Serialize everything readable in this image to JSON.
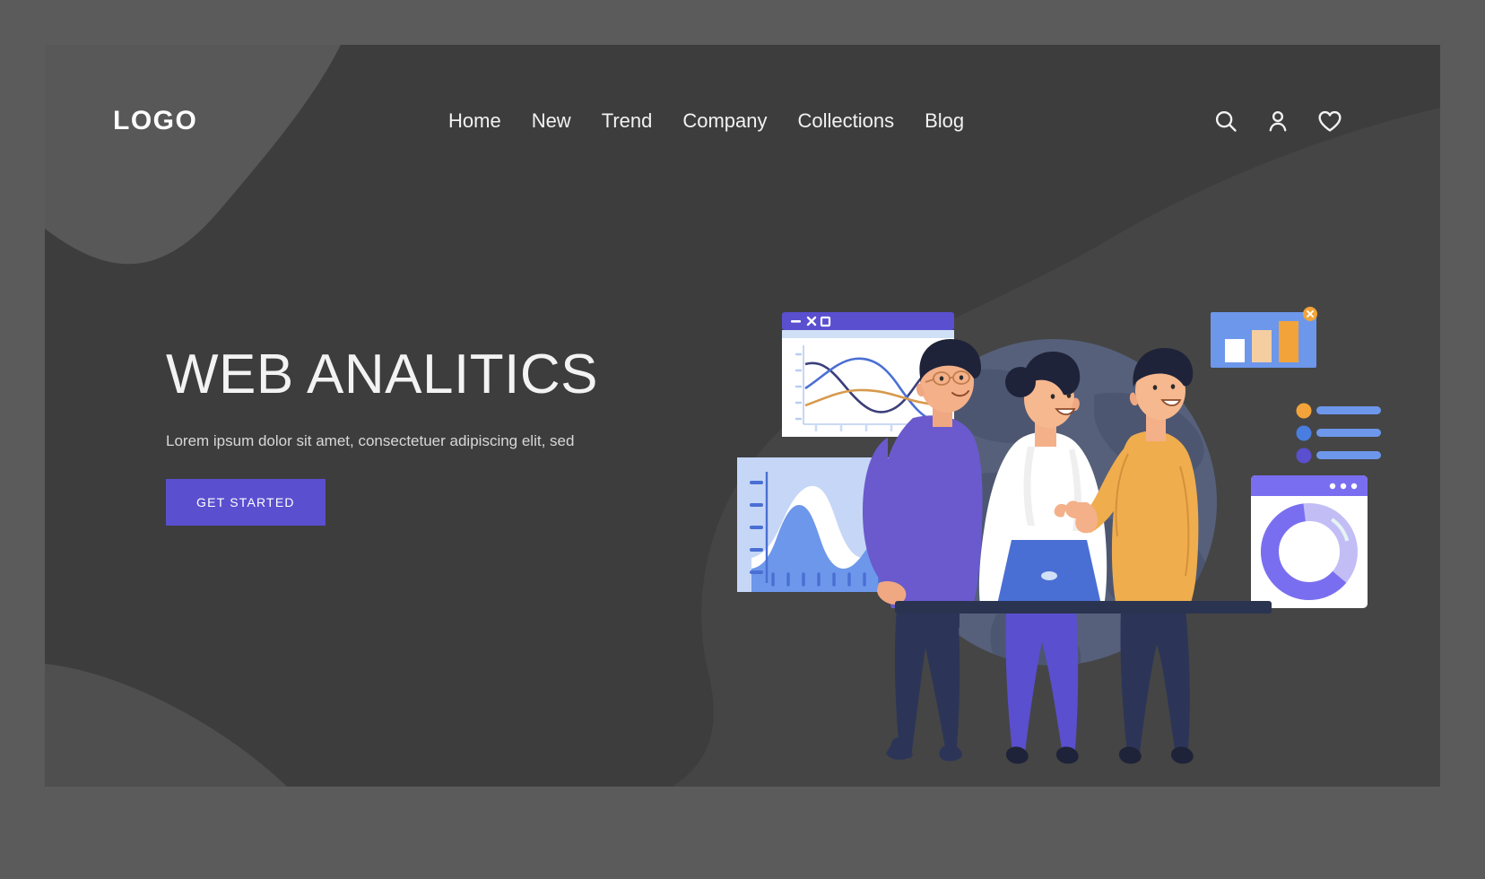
{
  "theme": {
    "outer_bg": "#5b5b5b",
    "panel_bg": "#454545",
    "blob_light": "#585858",
    "blob_dark": "#3d3d3d",
    "accent_purple": "#5a4fcf",
    "accent_orange": "#f2a43b",
    "accent_blue": "#6d97ea",
    "text_light": "#f3f3f3",
    "text_muted": "#d8d8d8"
  },
  "header": {
    "logo": "LOGO",
    "nav": [
      {
        "label": "Home"
      },
      {
        "label": "New"
      },
      {
        "label": "Trend"
      },
      {
        "label": "Company"
      },
      {
        "label": "Collections"
      },
      {
        "label": "Blog"
      }
    ],
    "icons": [
      {
        "name": "search-icon",
        "title": "Search"
      },
      {
        "name": "user-icon",
        "title": "Account"
      },
      {
        "name": "heart-icon",
        "title": "Favorites"
      }
    ]
  },
  "hero": {
    "headline": "WEB ANALITICS",
    "subhead": "Lorem ipsum dolor sit amet, consectetuer adipiscing elit, sed",
    "cta_label": "GET STARTED"
  },
  "illustration": {
    "line_chart_window": {
      "name": "line-chart-window",
      "titlebar_color": "#5a4fcf",
      "controls": [
        "minimize",
        "close",
        "maximize"
      ],
      "series": [
        {
          "name": "navy",
          "color": "#3b3f7a"
        },
        {
          "name": "blue",
          "color": "#4a6fd4"
        },
        {
          "name": "orange",
          "color": "#d79a4e"
        }
      ]
    },
    "area_chart_panel": {
      "name": "area-chart-panel",
      "bg_color": "#c5d6f7",
      "wave_color": "#6d97ea",
      "tick_count": 5,
      "axis_ticks_bottom": 9
    },
    "bar_chart_widget": {
      "name": "bar-chart-widget",
      "bg_color": "#6d97ea",
      "close_badge_color": "#f2a43b",
      "bars": [
        {
          "label": "bar-1",
          "value": 45,
          "color": "#ffffff"
        },
        {
          "label": "bar-2",
          "value": 68,
          "color": "#f4cda0"
        },
        {
          "label": "bar-3",
          "value": 92,
          "color": "#f2a43b"
        }
      ]
    },
    "list_widget": {
      "name": "list-widget",
      "rows": [
        {
          "dot_color": "#f2a43b",
          "bar_color": "#6d97ea"
        },
        {
          "dot_color": "#4a7de0",
          "bar_color": "#6d97ea"
        },
        {
          "dot_color": "#5a4fcf",
          "bar_color": "#6d97ea"
        }
      ]
    },
    "donut_chart_window": {
      "name": "donut-chart-window",
      "titlebar_color": "#7a6ef0",
      "dots": 3,
      "segments": [
        {
          "label": "major",
          "value": 62,
          "color": "#7a6ef0"
        },
        {
          "label": "minor",
          "value": 38,
          "color": "#c3bdf6"
        }
      ]
    },
    "people": [
      {
        "name": "person-left",
        "shirt_color": "#6a5acd",
        "has_glasses": true
      },
      {
        "name": "person-center",
        "shirt_color": "#ffffff",
        "has_laptop": true
      },
      {
        "name": "person-right",
        "shirt_color": "#efad4e",
        "pointing": true
      }
    ],
    "globe": {
      "name": "globe-backdrop",
      "color": "#56607a"
    },
    "desk": {
      "name": "desk-surface",
      "color": "#2a3350"
    }
  }
}
